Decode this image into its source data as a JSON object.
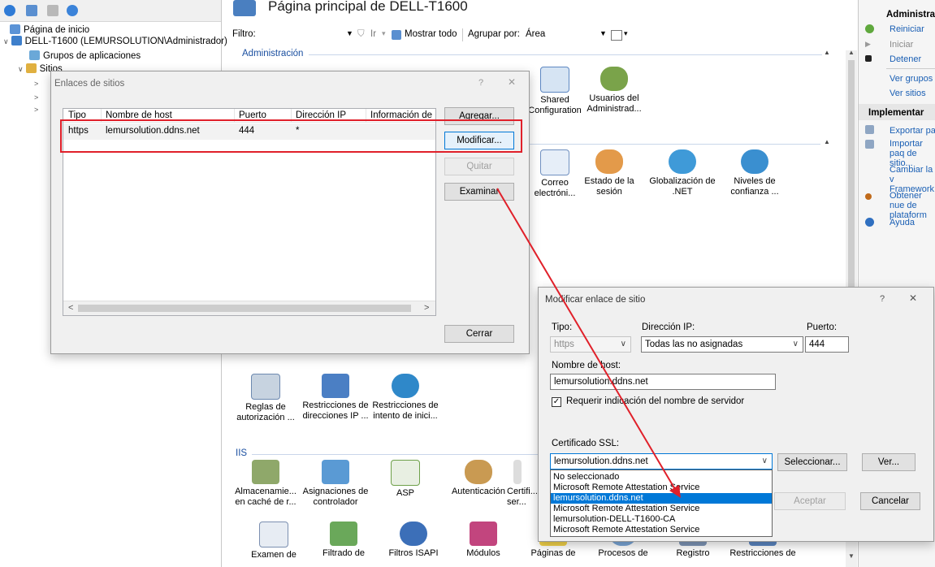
{
  "tree": {
    "items": [
      {
        "label": "Página de inicio"
      },
      {
        "label": "DELL-T1600 (LEMURSOLUTION\\Administrador)"
      },
      {
        "label": "Grupos de aplicaciones"
      },
      {
        "label": "Sitios"
      }
    ]
  },
  "main": {
    "title": "Página principal de DELL-T1600",
    "filter_label": "Filtro:",
    "go_label": "Ir",
    "show_all_label": "Mostrar todo",
    "group_by_label": "Agrupar por:",
    "group_by_value": "Área",
    "groups": [
      {
        "label": "Administración"
      },
      {
        "label": "IIS"
      }
    ],
    "features_row1": [
      {
        "label": "Shared Configuration",
        "short": "Shared\nnfiguration"
      },
      {
        "label": "Usuarios del Administrad..."
      }
    ],
    "features_row2": [
      {
        "label": "Correo electróni..."
      },
      {
        "label": "Estado de la sesión"
      },
      {
        "label": "Globalización de .NET"
      },
      {
        "label": "Niveles de confianza ..."
      }
    ],
    "features_ftp": [
      {
        "label": "Reglas de autorización ..."
      },
      {
        "label": "Restricciones de direcciones IP ..."
      },
      {
        "label": "Restricciones de intento de inici..."
      }
    ],
    "features_iis": [
      {
        "label": "Almacenamie... en caché de r..."
      },
      {
        "label": "Asignaciones de controlador"
      },
      {
        "label": "ASP"
      },
      {
        "label": "Autenticación"
      },
      {
        "label": "Certifi... ser..."
      }
    ],
    "features_bottom": [
      {
        "label": "Examen de"
      },
      {
        "label": "Filtrado de"
      },
      {
        "label": "Filtros ISAPI"
      },
      {
        "label": "Módulos"
      },
      {
        "label": "Páginas de"
      },
      {
        "label": "Procesos de"
      },
      {
        "label": "Registro"
      },
      {
        "label": "Restricciones de"
      }
    ]
  },
  "actions": {
    "header": "Administrar",
    "items": [
      {
        "label": "Reiniciar"
      },
      {
        "label": "Iniciar"
      },
      {
        "label": "Detener"
      },
      {
        "label": "Ver grupos d"
      },
      {
        "label": "Ver sitios"
      }
    ],
    "deploy_header": "Implementar",
    "deploy_items": [
      {
        "label": "Exportar paq"
      },
      {
        "label": "Importar paq de sitio..."
      },
      {
        "label": "Cambiar la v Framework"
      },
      {
        "label": "Obtener nue de plataform"
      },
      {
        "label": "Ayuda"
      }
    ]
  },
  "site_bindings": {
    "title": "Enlaces de sitios",
    "help": "?",
    "close": "✕",
    "columns": [
      "Tipo",
      "Nombre de host",
      "Puerto",
      "Dirección IP",
      "Información de"
    ],
    "rows": [
      {
        "type": "https",
        "host": "lemursolution.ddns.net",
        "port": "444",
        "ip": "*",
        "info": ""
      }
    ],
    "buttons": {
      "add": "Agregar...",
      "edit": "Modificar...",
      "remove": "Quitar",
      "browse": "Examinar",
      "close": "Cerrar"
    }
  },
  "edit_binding": {
    "title": "Modificar enlace de sitio",
    "help": "?",
    "close": "✕",
    "type_label": "Tipo:",
    "type_value": "https",
    "ip_label": "Dirección IP:",
    "ip_value": "Todas las no asignadas",
    "port_label": "Puerto:",
    "port_value": "444",
    "host_label": "Nombre de host:",
    "host_value": "lemursolution.ddns.net",
    "sni_label": "Requerir indicación del nombre de servidor",
    "sni_checked": true,
    "ssl_label": "Certificado SSL:",
    "ssl_value": "lemursolution.ddns.net",
    "ssl_options": [
      "No seleccionado",
      "Microsoft Remote Attestation Service",
      "lemursolution.ddns.net",
      "Microsoft Remote Attestation Service",
      "lemursolution-DELL-T1600-CA",
      "Microsoft Remote Attestation Service"
    ],
    "ssl_selected_index": 2,
    "select_button": "Seleccionar...",
    "view_button": "Ver...",
    "ok_button": "Aceptar",
    "cancel_button": "Cancelar"
  },
  "colors": {
    "accent": "#0078d7",
    "highlight_red": "#e0202a",
    "link": "#1a5fb4"
  }
}
